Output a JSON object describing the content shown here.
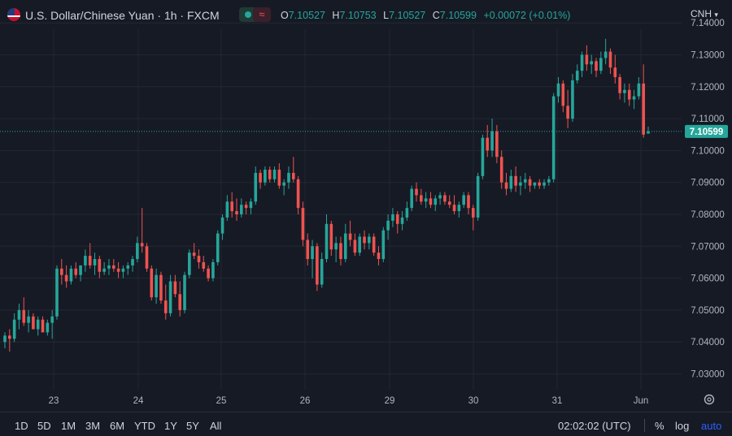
{
  "header": {
    "symbol_title": "U.S. Dollar/Chinese Yuan · 1h · FXCM",
    "ohlc": {
      "o_label": "O",
      "o_value": "7.10527",
      "h_label": "H",
      "h_value": "7.10753",
      "l_label": "L",
      "l_value": "7.10527",
      "c_label": "C",
      "c_value": "7.10599",
      "change": "+0.00072 (+0.01%)"
    },
    "status_icons": [
      "market-open-icon",
      "approximate-icon"
    ]
  },
  "currency": "CNH",
  "last_price_label": "7.10599",
  "colors": {
    "up": "#26a69a",
    "down": "#ef5350",
    "background": "#161a25",
    "grid": "#232733"
  },
  "footer": {
    "ranges": [
      "1D",
      "5D",
      "1M",
      "3M",
      "6M",
      "YTD",
      "1Y",
      "5Y",
      "All"
    ],
    "clock": "02:02:02 (UTC)",
    "percent_label": "%",
    "log_label": "log",
    "auto_label": "auto"
  },
  "chart_data": {
    "type": "candlestick",
    "interval": "1h",
    "ylim": [
      7.025,
      7.141
    ],
    "y_ticks": [
      "7.03000",
      "7.04000",
      "7.05000",
      "7.06000",
      "7.07000",
      "7.08000",
      "7.09000",
      "7.10000",
      "7.11000",
      "7.12000",
      "7.13000",
      "7.14000"
    ],
    "x_tick_labels": [
      "23",
      "24",
      "25",
      "26",
      "29",
      "30",
      "31",
      "Jun"
    ],
    "last_price": 7.10599,
    "candles": [
      [
        7.04,
        7.043,
        7.038,
        7.042
      ],
      [
        7.042,
        7.044,
        7.037,
        7.041
      ],
      [
        7.041,
        7.049,
        7.04,
        7.047
      ],
      [
        7.047,
        7.052,
        7.044,
        7.05
      ],
      [
        7.05,
        7.054,
        7.045,
        7.046
      ],
      [
        7.046,
        7.05,
        7.043,
        7.048
      ],
      [
        7.048,
        7.049,
        7.044,
        7.044
      ],
      [
        7.044,
        7.048,
        7.042,
        7.047
      ],
      [
        7.047,
        7.048,
        7.043,
        7.043
      ],
      [
        7.043,
        7.047,
        7.042,
        7.046
      ],
      [
        7.046,
        7.05,
        7.041,
        7.048
      ],
      [
        7.048,
        7.064,
        7.047,
        7.063
      ],
      [
        7.063,
        7.066,
        7.058,
        7.061
      ],
      [
        7.061,
        7.064,
        7.057,
        7.059
      ],
      [
        7.059,
        7.064,
        7.058,
        7.063
      ],
      [
        7.063,
        7.065,
        7.06,
        7.061
      ],
      [
        7.061,
        7.064,
        7.059,
        7.064
      ],
      [
        7.064,
        7.069,
        7.062,
        7.067
      ],
      [
        7.067,
        7.071,
        7.063,
        7.064
      ],
      [
        7.064,
        7.068,
        7.061,
        7.066
      ],
      [
        7.066,
        7.067,
        7.06,
        7.062
      ],
      [
        7.062,
        7.065,
        7.061,
        7.063
      ],
      [
        7.063,
        7.066,
        7.061,
        7.064
      ],
      [
        7.064,
        7.066,
        7.062,
        7.063
      ],
      [
        7.063,
        7.065,
        7.06,
        7.062
      ],
      [
        7.062,
        7.064,
        7.06,
        7.063
      ],
      [
        7.063,
        7.065,
        7.061,
        7.064
      ],
      [
        7.064,
        7.067,
        7.062,
        7.066
      ],
      [
        7.066,
        7.073,
        7.065,
        7.071
      ],
      [
        7.071,
        7.082,
        7.068,
        7.07
      ],
      [
        7.07,
        7.071,
        7.062,
        7.063
      ],
      [
        7.063,
        7.064,
        7.053,
        7.054
      ],
      [
        7.054,
        7.063,
        7.052,
        7.061
      ],
      [
        7.061,
        7.062,
        7.052,
        7.053
      ],
      [
        7.053,
        7.058,
        7.047,
        7.049
      ],
      [
        7.049,
        7.061,
        7.048,
        7.059
      ],
      [
        7.059,
        7.061,
        7.054,
        7.055
      ],
      [
        7.055,
        7.059,
        7.048,
        7.05
      ],
      [
        7.05,
        7.062,
        7.049,
        7.061
      ],
      [
        7.061,
        7.069,
        7.06,
        7.068
      ],
      [
        7.068,
        7.071,
        7.066,
        7.067
      ],
      [
        7.067,
        7.069,
        7.063,
        7.065
      ],
      [
        7.065,
        7.067,
        7.062,
        7.063
      ],
      [
        7.063,
        7.064,
        7.059,
        7.06
      ],
      [
        7.06,
        7.066,
        7.059,
        7.065
      ],
      [
        7.065,
        7.075,
        7.064,
        7.074
      ],
      [
        7.074,
        7.08,
        7.072,
        7.079
      ],
      [
        7.079,
        7.086,
        7.078,
        7.084
      ],
      [
        7.084,
        7.087,
        7.079,
        7.081
      ],
      [
        7.081,
        7.085,
        7.078,
        7.08
      ],
      [
        7.08,
        7.085,
        7.079,
        7.083
      ],
      [
        7.083,
        7.084,
        7.08,
        7.082
      ],
      [
        7.082,
        7.085,
        7.08,
        7.084
      ],
      [
        7.084,
        7.095,
        7.083,
        7.093
      ],
      [
        7.093,
        7.094,
        7.088,
        7.09
      ],
      [
        7.09,
        7.095,
        7.089,
        7.094
      ],
      [
        7.094,
        7.095,
        7.09,
        7.091
      ],
      [
        7.091,
        7.095,
        7.09,
        7.094
      ],
      [
        7.094,
        7.096,
        7.088,
        7.089
      ],
      [
        7.089,
        7.091,
        7.086,
        7.09
      ],
      [
        7.09,
        7.095,
        7.088,
        7.093
      ],
      [
        7.093,
        7.098,
        7.09,
        7.091
      ],
      [
        7.091,
        7.092,
        7.08,
        7.082
      ],
      [
        7.082,
        7.084,
        7.07,
        7.072
      ],
      [
        7.072,
        7.074,
        7.064,
        7.066
      ],
      [
        7.066,
        7.072,
        7.06,
        7.07
      ],
      [
        7.07,
        7.071,
        7.056,
        7.058
      ],
      [
        7.058,
        7.068,
        7.057,
        7.066
      ],
      [
        7.066,
        7.08,
        7.065,
        7.077
      ],
      [
        7.077,
        7.078,
        7.067,
        7.069
      ],
      [
        7.069,
        7.073,
        7.065,
        7.071
      ],
      [
        7.071,
        7.073,
        7.064,
        7.066
      ],
      [
        7.066,
        7.077,
        7.065,
        7.074
      ],
      [
        7.074,
        7.078,
        7.07,
        7.072
      ],
      [
        7.072,
        7.074,
        7.067,
        7.068
      ],
      [
        7.068,
        7.074,
        7.067,
        7.073
      ],
      [
        7.073,
        7.075,
        7.069,
        7.071
      ],
      [
        7.071,
        7.074,
        7.069,
        7.073
      ],
      [
        7.073,
        7.074,
        7.067,
        7.068
      ],
      [
        7.068,
        7.07,
        7.064,
        7.066
      ],
      [
        7.066,
        7.076,
        7.065,
        7.075
      ],
      [
        7.075,
        7.08,
        7.072,
        7.078
      ],
      [
        7.078,
        7.082,
        7.076,
        7.08
      ],
      [
        7.08,
        7.081,
        7.074,
        7.077
      ],
      [
        7.077,
        7.081,
        7.075,
        7.079
      ],
      [
        7.079,
        7.084,
        7.078,
        7.082
      ],
      [
        7.082,
        7.089,
        7.081,
        7.088
      ],
      [
        7.088,
        7.09,
        7.084,
        7.086
      ],
      [
        7.086,
        7.088,
        7.083,
        7.084
      ],
      [
        7.084,
        7.087,
        7.082,
        7.085
      ],
      [
        7.085,
        7.087,
        7.082,
        7.083
      ],
      [
        7.083,
        7.086,
        7.081,
        7.085
      ],
      [
        7.085,
        7.087,
        7.083,
        7.086
      ],
      [
        7.086,
        7.087,
        7.083,
        7.084
      ],
      [
        7.084,
        7.086,
        7.082,
        7.083
      ],
      [
        7.083,
        7.086,
        7.08,
        7.081
      ],
      [
        7.081,
        7.084,
        7.079,
        7.083
      ],
      [
        7.083,
        7.087,
        7.082,
        7.086
      ],
      [
        7.086,
        7.087,
        7.08,
        7.082
      ],
      [
        7.082,
        7.083,
        7.075,
        7.079
      ],
      [
        7.079,
        7.093,
        7.078,
        7.092
      ],
      [
        7.092,
        7.105,
        7.091,
        7.104
      ],
      [
        7.104,
        7.108,
        7.098,
        7.1
      ],
      [
        7.1,
        7.11,
        7.098,
        7.106
      ],
      [
        7.106,
        7.108,
        7.096,
        7.098
      ],
      [
        7.098,
        7.1,
        7.088,
        7.09
      ],
      [
        7.09,
        7.093,
        7.086,
        7.088
      ],
      [
        7.088,
        7.094,
        7.087,
        7.092
      ],
      [
        7.092,
        7.095,
        7.087,
        7.089
      ],
      [
        7.089,
        7.092,
        7.086,
        7.09
      ],
      [
        7.09,
        7.093,
        7.088,
        7.091
      ],
      [
        7.091,
        7.092,
        7.087,
        7.089
      ],
      [
        7.089,
        7.09,
        7.088,
        7.09
      ],
      [
        7.09,
        7.091,
        7.088,
        7.089
      ],
      [
        7.089,
        7.091,
        7.088,
        7.09
      ],
      [
        7.09,
        7.092,
        7.089,
        7.091
      ],
      [
        7.091,
        7.118,
        7.09,
        7.117
      ],
      [
        7.117,
        7.123,
        7.115,
        7.121
      ],
      [
        7.121,
        7.122,
        7.112,
        7.114
      ],
      [
        7.114,
        7.119,
        7.107,
        7.11
      ],
      [
        7.11,
        7.124,
        7.109,
        7.122
      ],
      [
        7.122,
        7.127,
        7.121,
        7.125
      ],
      [
        7.125,
        7.131,
        7.123,
        7.13
      ],
      [
        7.13,
        7.133,
        7.125,
        7.127
      ],
      [
        7.127,
        7.13,
        7.124,
        7.128
      ],
      [
        7.128,
        7.129,
        7.123,
        7.125
      ],
      [
        7.125,
        7.131,
        7.124,
        7.129
      ],
      [
        7.129,
        7.135,
        7.127,
        7.131
      ],
      [
        7.131,
        7.132,
        7.124,
        7.126
      ],
      [
        7.126,
        7.13,
        7.121,
        7.123
      ],
      [
        7.123,
        7.124,
        7.116,
        7.118
      ],
      [
        7.118,
        7.121,
        7.115,
        7.119
      ],
      [
        7.119,
        7.121,
        7.114,
        7.116
      ],
      [
        7.116,
        7.119,
        7.113,
        7.117
      ],
      [
        7.117,
        7.123,
        7.116,
        7.121
      ],
      [
        7.121,
        7.127,
        7.104,
        7.105
      ],
      [
        7.1053,
        7.1075,
        7.1053,
        7.106
      ]
    ]
  }
}
